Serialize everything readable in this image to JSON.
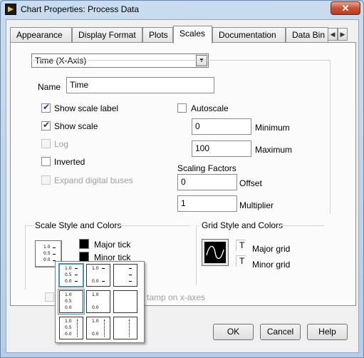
{
  "window": {
    "title": "Chart Properties: Process Data",
    "close_label": "✕"
  },
  "tabs": [
    {
      "label": "Appearance"
    },
    {
      "label": "Display Format"
    },
    {
      "label": "Plots"
    },
    {
      "label": "Scales",
      "active": true
    },
    {
      "label": "Documentation"
    },
    {
      "label": "Data Bin"
    }
  ],
  "tab_scroll": {
    "left": "◀",
    "right": "▶"
  },
  "axis_select": {
    "value": "Time (X-Axis)",
    "arrow": "▼"
  },
  "name": {
    "label": "Name",
    "value": "Time"
  },
  "options": {
    "show_scale_label": {
      "label": "Show scale label",
      "checked": true
    },
    "show_scale": {
      "label": "Show scale",
      "checked": true
    },
    "log": {
      "label": "Log",
      "checked": false,
      "disabled": true
    },
    "inverted": {
      "label": "Inverted",
      "checked": false
    },
    "expand_digital": {
      "label": "Expand digital buses",
      "checked": false,
      "disabled": true
    }
  },
  "autoscale": {
    "label": "Autoscale",
    "checked": false
  },
  "minimum": {
    "value": "0",
    "label": "Minimum"
  },
  "maximum": {
    "value": "100",
    "label": "Maximum"
  },
  "scaling": {
    "title": "Scaling Factors",
    "offset_value": "0",
    "offset_label": "Offset",
    "multiplier_value": "1",
    "multiplier_label": "Multiplier"
  },
  "scale_style": {
    "title": "Scale Style and Colors",
    "major_tick": "Major tick",
    "minor_tick": "Minor tick"
  },
  "grid_style": {
    "title": "Grid Style and Colors",
    "major_grid": "Major grid",
    "minor_grid": "Minor grid"
  },
  "partial_checkbox_label": "tamp on x-axes",
  "ticks": {
    "top": "1.0",
    "mid": "0.5",
    "bot": "0.0"
  },
  "buttons": {
    "ok": "OK",
    "cancel": "Cancel",
    "help": "Help"
  },
  "colors": {
    "selection": "#4b8ad6",
    "window": "#b9d1ea"
  }
}
